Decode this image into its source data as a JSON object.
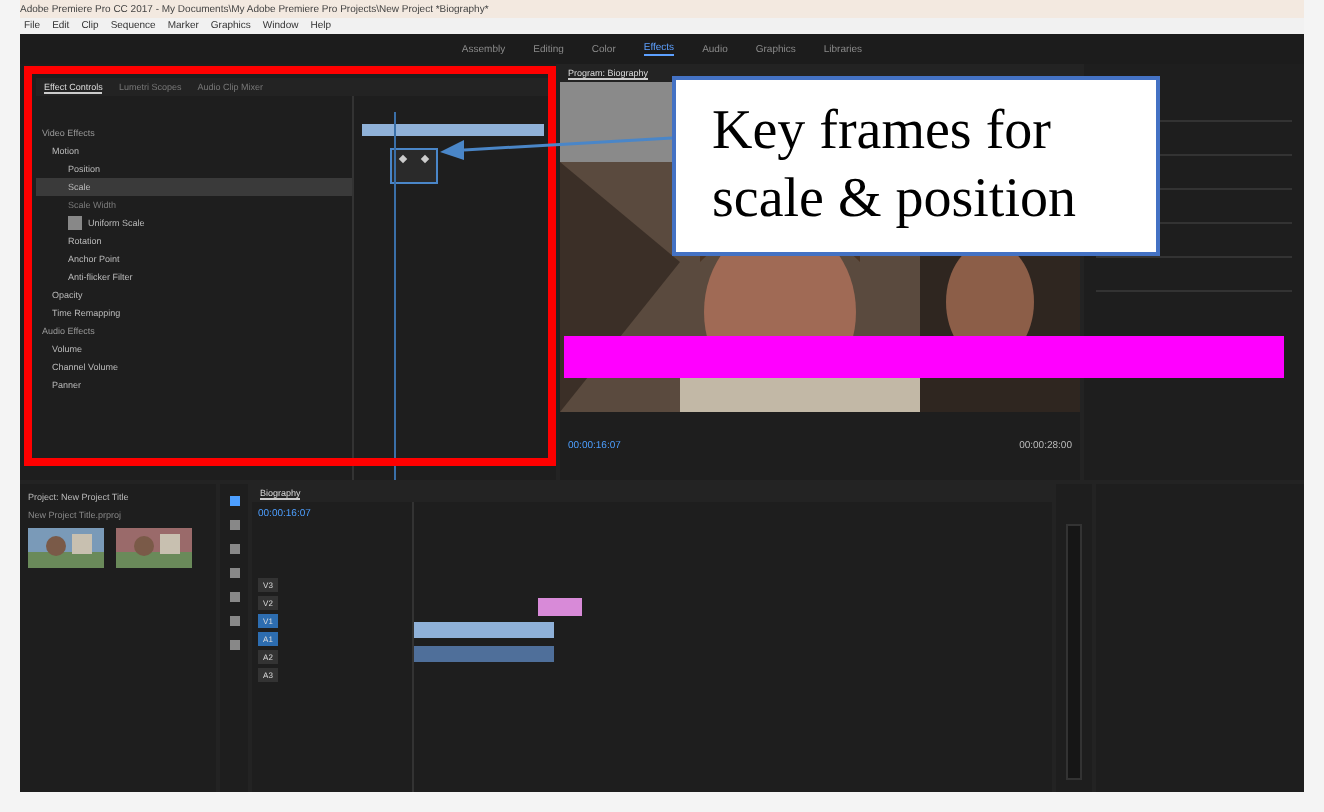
{
  "title_bar": {
    "title": "Adobe Premiere Pro CC 2017 - My Documents\\My Adobe Premiere Pro Projects\\New Project *Biography*"
  },
  "menu": [
    "File",
    "Edit",
    "Clip",
    "Sequence",
    "Marker",
    "Graphics",
    "Window",
    "Help"
  ],
  "workspaces": [
    {
      "label": "Assembly",
      "selected": false
    },
    {
      "label": "Editing",
      "selected": false
    },
    {
      "label": "Color",
      "selected": false
    },
    {
      "label": "Effects",
      "selected": true
    },
    {
      "label": "Audio",
      "selected": false
    },
    {
      "label": "Graphics",
      "selected": false
    },
    {
      "label": "Libraries",
      "selected": false
    }
  ],
  "effect_controls": {
    "tabs": [
      {
        "label": "Effect Controls",
        "selected": true
      },
      {
        "label": "Lumetri Scopes",
        "selected": false
      },
      {
        "label": "Audio Clip Mixer",
        "selected": false
      }
    ],
    "properties": [
      {
        "kind": "header",
        "label": "Video Effects",
        "selected": false,
        "disabled": false
      },
      {
        "kind": "effect",
        "label": "Motion",
        "selected": false,
        "disabled": false
      },
      {
        "kind": "property",
        "label": "Position",
        "selected": false,
        "disabled": false
      },
      {
        "kind": "property",
        "label": "Scale",
        "selected": true,
        "disabled": false
      },
      {
        "kind": "property",
        "label": "Scale Width",
        "selected": false,
        "disabled": true
      },
      {
        "kind": "checkbox",
        "label": "Uniform Scale",
        "checked": true,
        "selected": false,
        "disabled": false
      },
      {
        "kind": "property",
        "label": "Rotation",
        "selected": false,
        "disabled": false
      },
      {
        "kind": "property",
        "label": "Anchor Point",
        "selected": false,
        "disabled": false
      },
      {
        "kind": "property",
        "label": "Anti-flicker Filter",
        "selected": false,
        "disabled": false
      },
      {
        "kind": "effect",
        "label": "Opacity",
        "selected": false,
        "disabled": false
      },
      {
        "kind": "effect",
        "label": "Time Remapping",
        "selected": false,
        "disabled": false
      },
      {
        "kind": "header",
        "label": "Audio Effects",
        "selected": false,
        "disabled": false
      },
      {
        "kind": "effect",
        "label": "Volume",
        "selected": false,
        "disabled": false
      },
      {
        "kind": "effect",
        "label": "Channel Volume",
        "selected": false,
        "disabled": false
      },
      {
        "kind": "effect",
        "label": "Panner",
        "selected": false,
        "disabled": false
      }
    ]
  },
  "program_monitor": {
    "title": "Program: Biography",
    "timecode": "00:00:16:07",
    "duration": "00:00:28:00"
  },
  "project_panel": {
    "title": "Project: New Project Title",
    "file": "New Project Title.prproj"
  },
  "timeline": {
    "title": "Biography",
    "timecode": "00:00:16:07",
    "tracks": [
      "V3",
      "V2",
      "V1",
      "A1",
      "A2",
      "A3"
    ]
  },
  "annotation": {
    "text": "Key frames for scale & position"
  }
}
